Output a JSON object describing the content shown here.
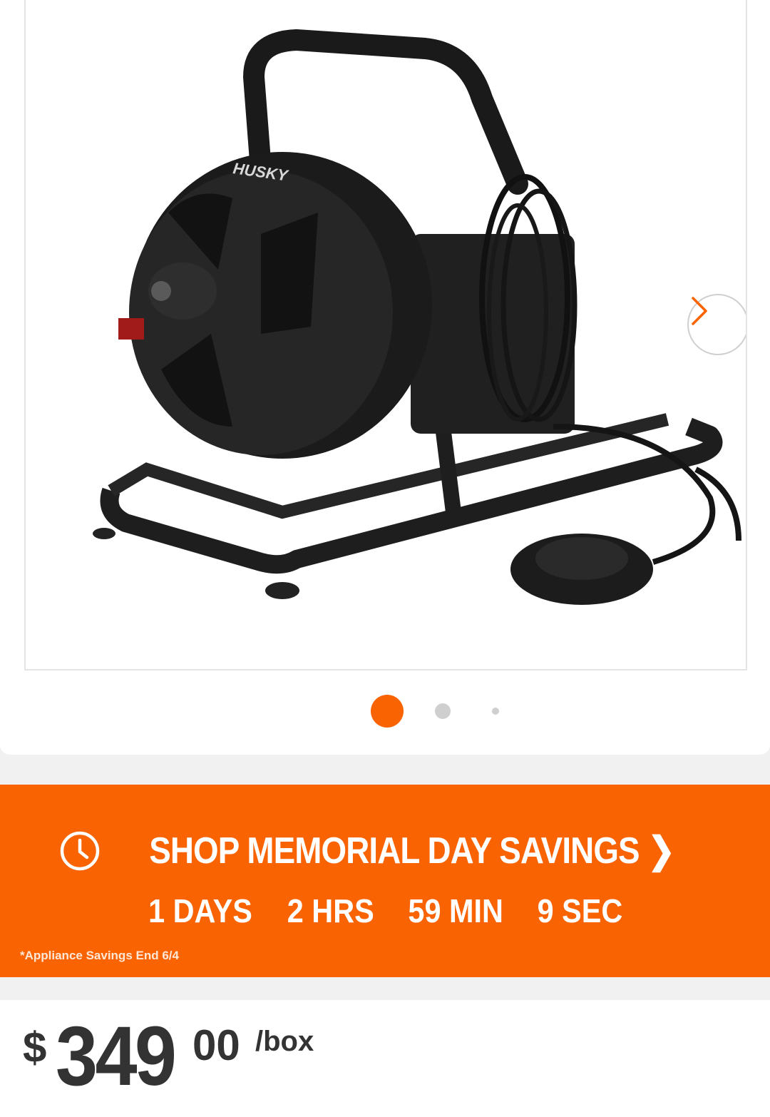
{
  "product_image": {
    "brand_text": "HUSKY"
  },
  "carousel": {
    "active_index": 0,
    "count": 3
  },
  "promo": {
    "headline": "SHOP MEMORIAL DAY SAVINGS ❯",
    "countdown": [
      "1 DAYS",
      "2 HRS",
      "59 MIN",
      "9 SEC"
    ],
    "footnote": "*Appliance Savings End 6/4",
    "color": "#f96302"
  },
  "price": {
    "currency": "$",
    "dollars": "349",
    "cents": "00",
    "unit": "/box"
  }
}
